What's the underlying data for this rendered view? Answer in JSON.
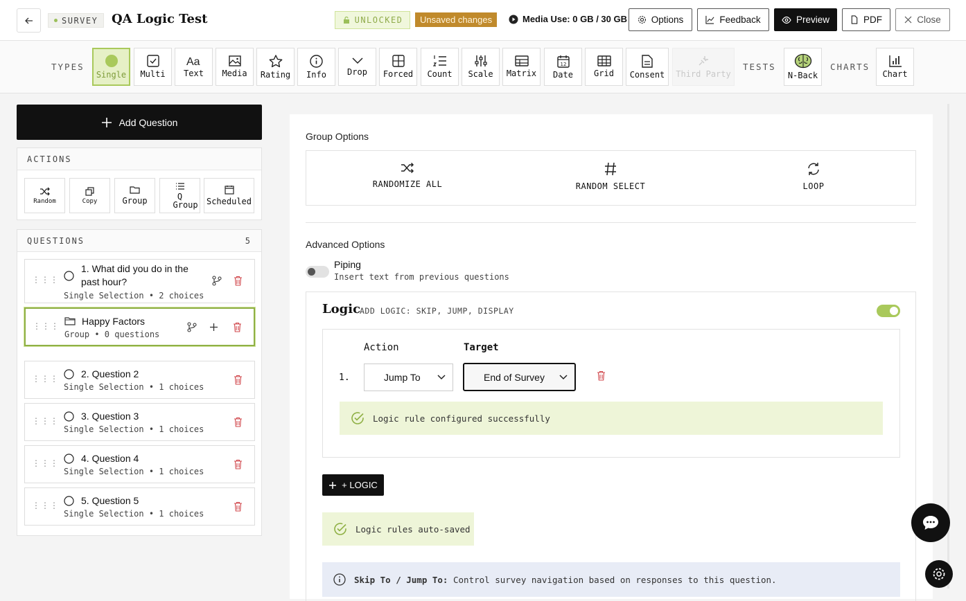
{
  "topbar": {
    "badge": "SURVEY",
    "title": "QA Logic Test",
    "lock_status": "UNLOCKED",
    "unsaved": "Unsaved changes",
    "media_use": "Media Use: 0 GB / 30 GB",
    "options": "Options",
    "feedback": "Feedback",
    "preview": "Preview",
    "pdf": "PDF",
    "close": "Close"
  },
  "types": {
    "label": "TYPES",
    "items": [
      "Single",
      "Multi",
      "Text",
      "Media",
      "Rating",
      "Info",
      "Drop",
      "Forced",
      "Count",
      "Scale",
      "Matrix",
      "Date",
      "Grid",
      "Consent",
      "Third Party"
    ],
    "active": "Single",
    "tests_label": "TESTS",
    "nback": "N-Back",
    "charts_label": "CHARTS",
    "chart": "Chart"
  },
  "sidebar": {
    "add_question": "Add Question",
    "actions_label": "ACTIONS",
    "actions": [
      "Random",
      "Copy",
      "Group",
      "Q Group",
      "Scheduled"
    ],
    "questions_label": "QUESTIONS",
    "questions_count": "5",
    "questions": [
      {
        "title": "1. What did you do in the past hour?",
        "sub": "Single Selection • 2 choices"
      },
      {
        "title": "Happy Factors",
        "sub": "Group • 0 questions"
      },
      {
        "title": "2. Question 2",
        "sub": "Single Selection • 1 choices"
      },
      {
        "title": "3. Question 3",
        "sub": "Single Selection • 1 choices"
      },
      {
        "title": "4. Question 4",
        "sub": "Single Selection • 1 choices"
      },
      {
        "title": "5. Question 5",
        "sub": "Single Selection • 1 choices"
      }
    ]
  },
  "main": {
    "group_options": "Group Options",
    "randomize_all": "RANDOMIZE ALL",
    "random_select": "RANDOM SELECT",
    "loop": "LOOP",
    "advanced_options": "Advanced Options",
    "piping": "Piping",
    "piping_desc": "Insert text from previous questions",
    "logic_title": "Logic",
    "logic_sub": "ADD LOGIC: SKIP, JUMP, DISPLAY",
    "action_col": "Action",
    "target_col": "Target",
    "rule_num": "1.",
    "action_value": "Jump To",
    "target_value": "End of Survey",
    "rule_success": "Logic rule configured successfully",
    "add_logic": "+ LOGIC",
    "auto_saved": "Logic rules auto-saved",
    "info_bold": "Skip To / Jump To:",
    "info_text": " Control survey navigation based on responses to this question."
  },
  "colors": {
    "accent_green": "#a9c95b",
    "unsaved_bg": "#c08a2c",
    "dark": "#111111",
    "delete_red": "#d0454a"
  }
}
